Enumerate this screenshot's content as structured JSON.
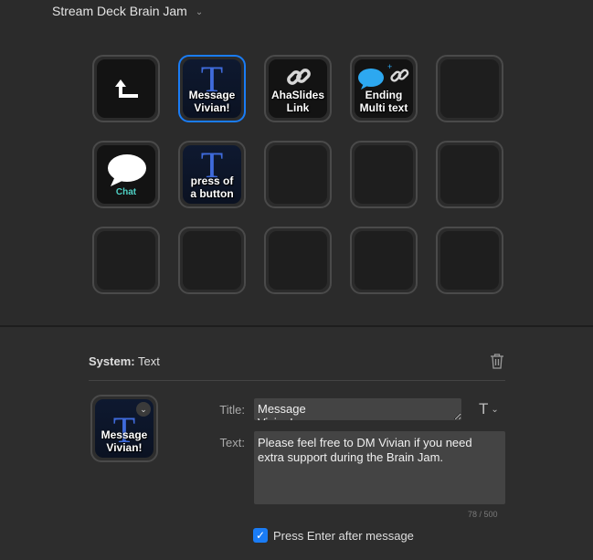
{
  "profile": {
    "name": "Stream Deck Brain Jam",
    "dropdown_icon": "chevron-down-icon"
  },
  "keys": {
    "message_vivian": "Message\nVivian!",
    "ahaslides_link": "AhaSlides\nLink",
    "ending_multi_text": "Ending\nMulti text",
    "chat": "Chat",
    "press_button": "press of\na button",
    "text_glyph": "T"
  },
  "inspector": {
    "plugin_label": "System:",
    "action_label": "Text",
    "trash_icon": "trash-icon",
    "preview_title": "Message\nVivian!",
    "title_label": "Title:",
    "title_value": "Message\nVivian!",
    "text_label": "Text:",
    "text_value": "Please feel free to DM Vivian if you need extra support during the Brain Jam.",
    "counter": "78 / 500",
    "font_button": "T",
    "checkbox_label": "Press Enter after message",
    "checkbox_checked": true
  },
  "colors": {
    "accent": "#1a7cf5",
    "text_glyph": "#3f6bdc",
    "chat_label": "#4fd1c5",
    "background": "#2b2b2b"
  }
}
